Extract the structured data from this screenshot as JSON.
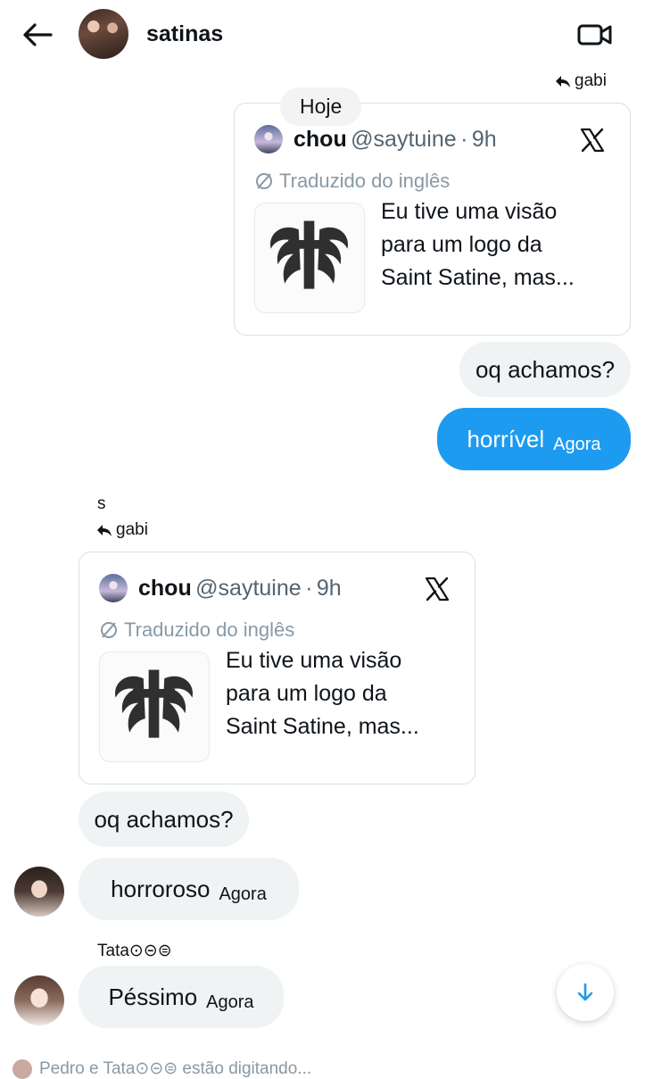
{
  "header": {
    "title": "satinas",
    "back_icon": "arrow-left-icon",
    "video_icon": "video-camera-icon"
  },
  "day_separator": "Hoje",
  "thread": [
    {
      "reply_to": "gabi",
      "card": {
        "name": "chou",
        "handle": "@saytuine",
        "dot": "·",
        "time": "9h",
        "translated": "Traduzido do inglês",
        "text_lines": [
          "Eu tive uma visão",
          "para um logo da",
          "Saint Satine, mas..."
        ]
      },
      "bubbles": [
        {
          "text": "oq achamos?"
        },
        {
          "text": "horrível",
          "time": "Agora"
        }
      ]
    },
    {
      "sender": "s",
      "reply_to": "gabi",
      "card": {
        "name": "chou",
        "handle": "@saytuine",
        "dot": "·",
        "time": "9h",
        "translated": "Traduzido do inglês",
        "text_lines": [
          "Eu tive uma visão",
          "para um logo da",
          "Saint Satine, mas..."
        ]
      },
      "bubbles": [
        {
          "text": "oq achamos?"
        },
        {
          "text": "horroroso",
          "time": "Agora"
        }
      ]
    },
    {
      "sender": "Tata⊙⊝⊜",
      "bubbles": [
        {
          "text": "Péssimo",
          "time": "Agora"
        }
      ]
    }
  ],
  "typing_indicator": "Pedro e Tata⊙⊝⊜ estão digitando...",
  "colors": {
    "accent": "#1d9bf0",
    "bubble_gray": "#eff3f4",
    "muted": "#536471"
  }
}
